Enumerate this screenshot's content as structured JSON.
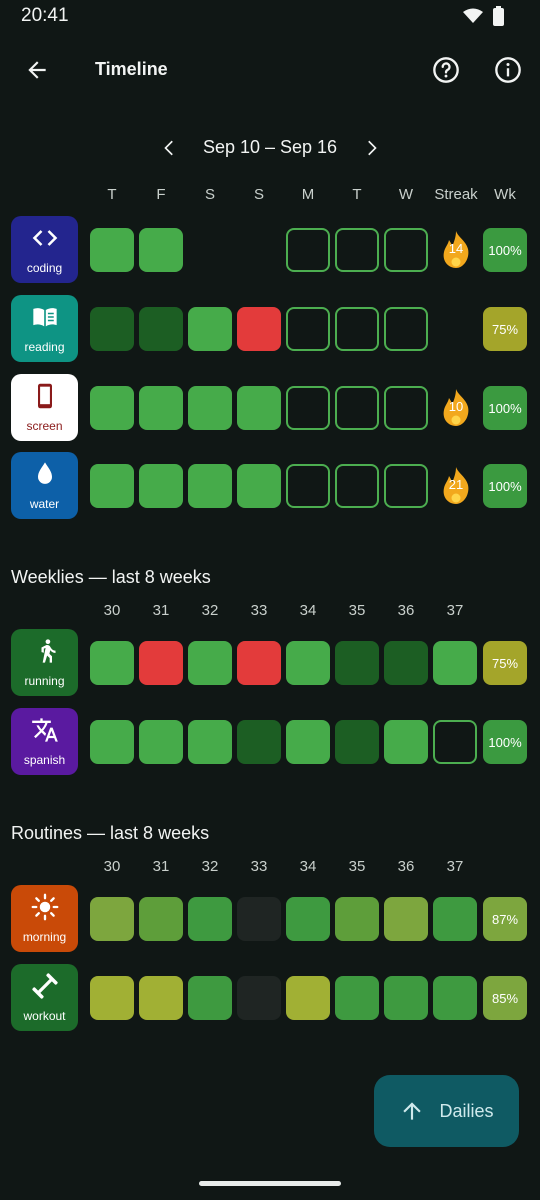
{
  "status_bar": {
    "time": "20:41"
  },
  "app_bar": {
    "title": "Timeline"
  },
  "week_nav": {
    "range": "Sep 10 – Sep 16"
  },
  "daily_headers": {
    "days": [
      "T",
      "F",
      "S",
      "S",
      "M",
      "T",
      "W"
    ],
    "streak": "Streak",
    "wk": "Wk"
  },
  "dailies": [
    {
      "label": "coding",
      "icon": "code-icon",
      "icon_bg": "#23258e",
      "label_color": "#ffffff",
      "cells": [
        "done",
        "done",
        "blank",
        "blank",
        "empty",
        "empty",
        "empty"
      ],
      "streak": "14",
      "wk": "100%",
      "wk_color": "#3b9a40"
    },
    {
      "label": "reading",
      "icon": "book-icon",
      "icon_bg": "#0e9484",
      "label_color": "#ffffff",
      "cells": [
        "dark",
        "dark",
        "done",
        "miss",
        "empty",
        "empty",
        "empty"
      ],
      "streak": "",
      "wk": "75%",
      "wk_color": "#a4a52a"
    },
    {
      "label": "screen",
      "icon": "smartphone-icon",
      "icon_bg": "#ffffff",
      "label_color": "#8a1a1a",
      "cells": [
        "done",
        "done",
        "done",
        "done",
        "empty",
        "empty",
        "empty"
      ],
      "streak": "10",
      "wk": "100%",
      "wk_color": "#3b9a40"
    },
    {
      "label": "water",
      "icon": "water-drop-icon",
      "icon_bg": "#0d60a8",
      "label_color": "#ffffff",
      "cells": [
        "done",
        "done",
        "done",
        "done",
        "empty",
        "empty",
        "empty"
      ],
      "streak": "21",
      "wk": "100%",
      "wk_color": "#3b9a40"
    }
  ],
  "weeklies": {
    "title": "Weeklies — last 8 weeks",
    "weeks": [
      "30",
      "31",
      "32",
      "33",
      "34",
      "35",
      "36",
      "37"
    ],
    "rows": [
      {
        "label": "running",
        "icon": "running-icon",
        "icon_bg": "#1c6b2a",
        "cells": [
          "done",
          "miss",
          "done",
          "miss",
          "done",
          "dark",
          "dark",
          "done"
        ],
        "wk": "75%",
        "wk_color": "#a4a52a"
      },
      {
        "label": "spanish",
        "icon": "translate-icon",
        "icon_bg": "#5a1aa0",
        "cells": [
          "done",
          "done",
          "done",
          "dark",
          "done",
          "dark",
          "done",
          "empty"
        ],
        "wk": "100%",
        "wk_color": "#3b9a40"
      }
    ]
  },
  "routines": {
    "title": "Routines — last 8 weeks",
    "weeks": [
      "30",
      "31",
      "32",
      "33",
      "34",
      "35",
      "36",
      "37"
    ],
    "rows": [
      {
        "label": "morning",
        "icon": "sun-icon",
        "icon_bg": "#c94a08",
        "cells": [
          "#7da63e",
          "#5e9e3a",
          "#3e9a40",
          "muted",
          "#3e9a40",
          "#5e9e3a",
          "#7da63e",
          "#3e9a40"
        ],
        "wk": "87%",
        "wk_color": "#7da63e"
      },
      {
        "label": "workout",
        "icon": "dumbbell-icon",
        "icon_bg": "#1c6b2a",
        "cells": [
          "#a1b034",
          "#a1b034",
          "#3e9a40",
          "muted",
          "#a1b034",
          "#3e9a40",
          "#3e9a40",
          "#3e9a40"
        ],
        "wk": "85%",
        "wk_color": "#7da63e"
      }
    ]
  },
  "fab": {
    "label": "Dailies",
    "icon": "arrow-up-icon"
  },
  "colors": {
    "done": "#46ab4a",
    "dark": "#1c5e23",
    "miss": "#e33b3b",
    "empty_border": "#4cae50",
    "flame": "#f2a81d"
  }
}
